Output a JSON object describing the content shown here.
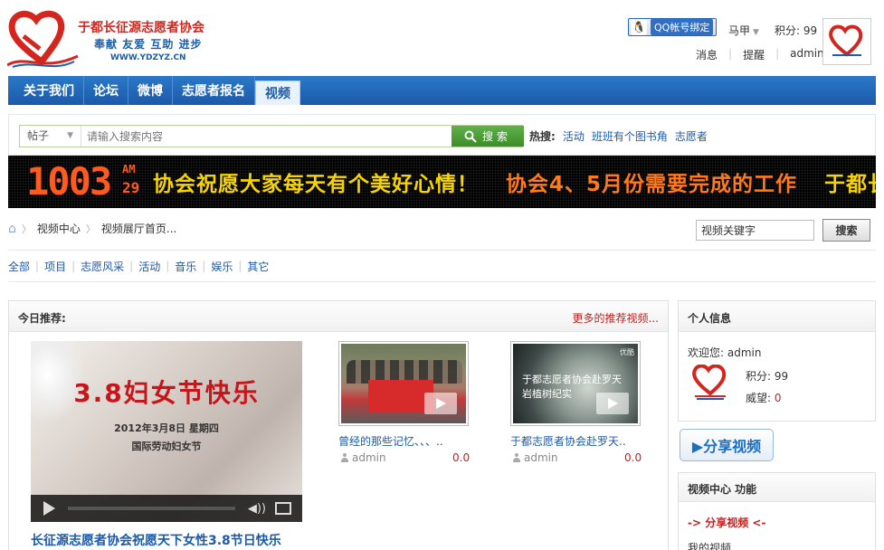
{
  "header": {
    "org_name": "于都长征源志愿者协会",
    "slogan": "奉献 友爱 互助 进步",
    "site": "WWW.YDZYZ.CN",
    "qq_bind": "QQ帐号绑定",
    "user_name": "马甲",
    "credit_label": "积分: 99",
    "links": [
      "消息",
      "提醒",
      "admin"
    ]
  },
  "nav": {
    "items": [
      "关于我们",
      "论坛",
      "微博",
      "志愿者报名",
      "视频"
    ],
    "active_index": 4
  },
  "search": {
    "type": "帖子",
    "placeholder": "请输入搜索内容",
    "button": "搜索",
    "hot_label": "热搜:",
    "hot_items": [
      "活动",
      "班班有个图书角",
      "志愿者"
    ]
  },
  "banner": {
    "clock_time": "1003",
    "clock_ampm": "AM",
    "clock_seconds": "29",
    "messages": [
      "协会祝愿大家每天有个美好心情！",
      "协会4、5月份需要完成的工作",
      "于都长"
    ]
  },
  "breadcrumb": [
    "视频中心",
    "视频展厅首页..."
  ],
  "video_search": {
    "value": "视频关键字",
    "button": "搜索"
  },
  "categories": [
    "全部",
    "项目",
    "志愿风采",
    "活动",
    "音乐",
    "娱乐",
    "其它"
  ],
  "main": {
    "title": "今日推荐:",
    "more": "更多的推荐视频...",
    "feature": {
      "headline": "3.8妇女节快乐",
      "date_line": "2012年3月8日 星期四",
      "day_line": "国际劳动妇女节",
      "title": "长征源志愿者协会祝愿天下女性3.8节日快乐"
    },
    "thumbs": [
      {
        "title": "曾经的那些记忆、、、..",
        "user": "admin",
        "score": "0.0"
      },
      {
        "title": "于都志愿者协会赴罗天..",
        "user": "admin",
        "score": "0.0",
        "overlay": "于都志愿者协会赴罗天岩植树纪实",
        "corner": "优酷"
      }
    ]
  },
  "side": {
    "personal_title": "个人信息",
    "welcome": "欢迎您: admin",
    "credit": "积分: 99",
    "prestige_label": "威望:",
    "prestige_value": "0",
    "share_button": "▶分享视频",
    "func_title": "视频中心  功能",
    "share_link": "-> 分享视频 <-",
    "my_video": "我的视频"
  },
  "colors": {
    "nav_blue": "#1b5aa8",
    "accent_red": "#c41f1f",
    "search_green": "#3d8c2a",
    "banner_yellow": "#f6d400",
    "banner_orange": "#ff7a1a"
  }
}
